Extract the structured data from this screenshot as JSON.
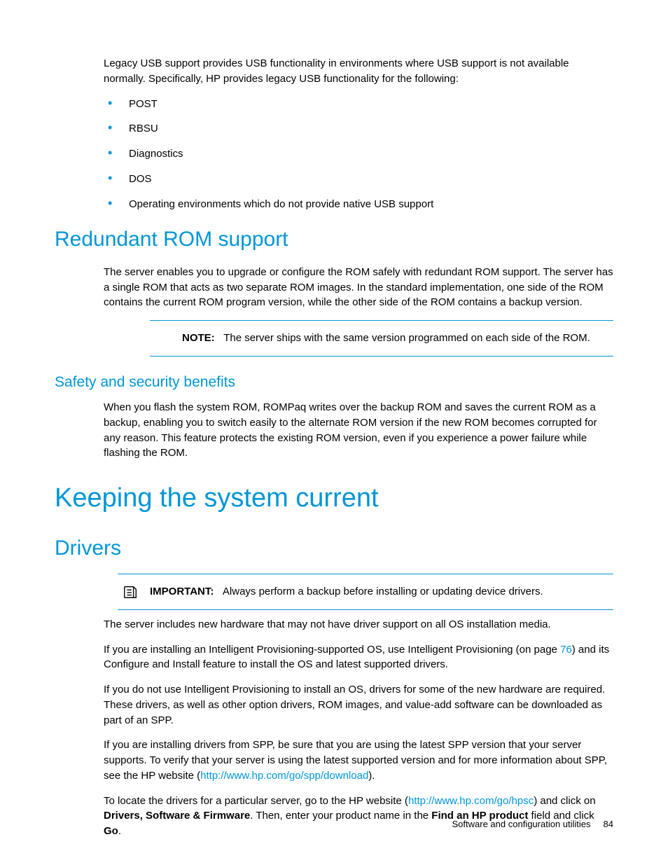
{
  "intro": {
    "para": "Legacy USB support provides USB functionality in environments where USB support is not available normally. Specifically, HP provides legacy USB functionality for the following:",
    "bullets": [
      "POST",
      "RBSU",
      "Diagnostics",
      "DOS",
      "Operating environments which do not provide native USB support"
    ]
  },
  "section_redundant": {
    "heading": "Redundant ROM support",
    "para": "The server enables you to upgrade or configure the ROM safely with redundant ROM support. The server has a single ROM that acts as two separate ROM images. In the standard implementation, one side of the ROM contains the current ROM program version, while the other side of the ROM contains a backup version.",
    "note_label": "NOTE:",
    "note_text": "The server ships with the same version programmed on each side of the ROM."
  },
  "section_safety": {
    "heading": "Safety and security benefits",
    "para": "When you flash the system ROM, ROMPaq writes over the backup ROM and saves the current ROM as a backup, enabling you to switch easily to the alternate ROM version if the new ROM becomes corrupted for any reason. This feature protects the existing ROM version, even if you experience a power failure while flashing the ROM."
  },
  "section_keeping": {
    "heading": "Keeping the system current"
  },
  "section_drivers": {
    "heading": "Drivers",
    "important_label": "IMPORTANT:",
    "important_text": "Always perform a backup before installing or updating device drivers.",
    "p1": "The server includes new hardware that may not have driver support on all OS installation media.",
    "p2a": "If you are installing an Intelligent Provisioning-supported OS, use Intelligent Provisioning (on page ",
    "p2_link": "76",
    "p2b": ") and its Configure and Install feature to install the OS and latest supported drivers.",
    "p3": "If you do not use Intelligent Provisioning to install an OS, drivers for some of the new hardware are required. These drivers, as well as other option drivers, ROM images, and value-add software can be downloaded as part of an SPP.",
    "p4a": "If you are installing drivers from SPP, be sure that you are using the latest SPP version that your server supports. To verify that your server is using the latest supported version and for more information about SPP, see the HP website (",
    "p4_link": "http://www.hp.com/go/spp/download",
    "p4b": ").",
    "p5a": "To locate the drivers for a particular server, go to the HP website (",
    "p5_link": "http://www.hp.com/go/hpsc",
    "p5b": ") and click on ",
    "p5_bold1": "Drivers, Software & Firmware",
    "p5c": ". Then, enter your product name in the ",
    "p5_bold2": "Find an HP product",
    "p5d": " field and click ",
    "p5_bold3": "Go",
    "p5e": "."
  },
  "footer": {
    "section": "Software and configuration utilities",
    "page": "84"
  }
}
